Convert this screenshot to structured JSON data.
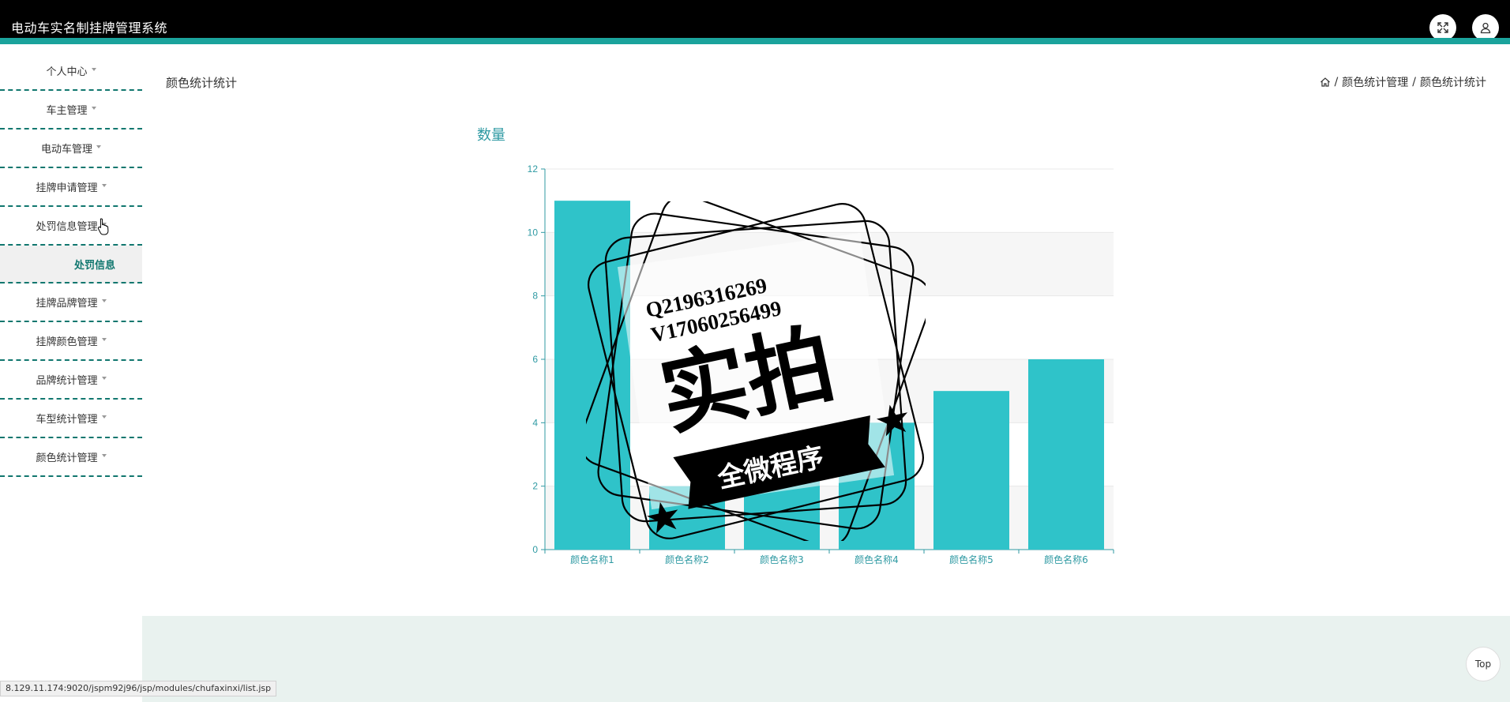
{
  "app": {
    "title": "电动车实名制挂牌管理系统"
  },
  "header": {
    "fullscreen_icon": "expand-icon",
    "user_icon": "user-icon"
  },
  "sidebar": {
    "items": [
      {
        "label": "个人中心"
      },
      {
        "label": "车主管理"
      },
      {
        "label": "电动车管理"
      },
      {
        "label": "挂牌申请管理"
      },
      {
        "label": "处罚信息管理"
      },
      {
        "label": "挂牌品牌管理"
      },
      {
        "label": "挂牌颜色管理"
      },
      {
        "label": "品牌统计管理"
      },
      {
        "label": "车型统计管理"
      },
      {
        "label": "颜色统计管理"
      }
    ],
    "submenu": {
      "label": "处罚信息"
    }
  },
  "page": {
    "title": "颜色统计统计",
    "breadcrumb": {
      "home_icon": "home-icon",
      "level1": "颜色统计管理",
      "sep": "/",
      "level2": "颜色统计统计"
    }
  },
  "chart_data": {
    "type": "bar",
    "title": "",
    "ylabel": "数量",
    "xlabel": "",
    "categories": [
      "颜色名称1",
      "颜色名称2",
      "颜色名称3",
      "颜色名称4",
      "颜色名称5",
      "颜色名称6"
    ],
    "values": [
      11,
      2,
      3,
      4,
      5,
      6
    ],
    "ylim": [
      0,
      12
    ],
    "yticks": [
      0,
      2,
      4,
      6,
      8,
      10,
      12
    ],
    "grid": true,
    "colors": {
      "bar": "#2fc3c9",
      "axis": "#2f9aa3",
      "band": "#f6f6f6"
    }
  },
  "watermark": {
    "line1": "Q2196316269",
    "line2": "V17060256499",
    "big": "实拍",
    "ribbon": "全微程序"
  },
  "status_bar": {
    "url": "8.129.11.174:9020/jspm92j96/jsp/modules/chufaxinxi/list.jsp"
  },
  "back_to_top": {
    "label": "Top"
  }
}
